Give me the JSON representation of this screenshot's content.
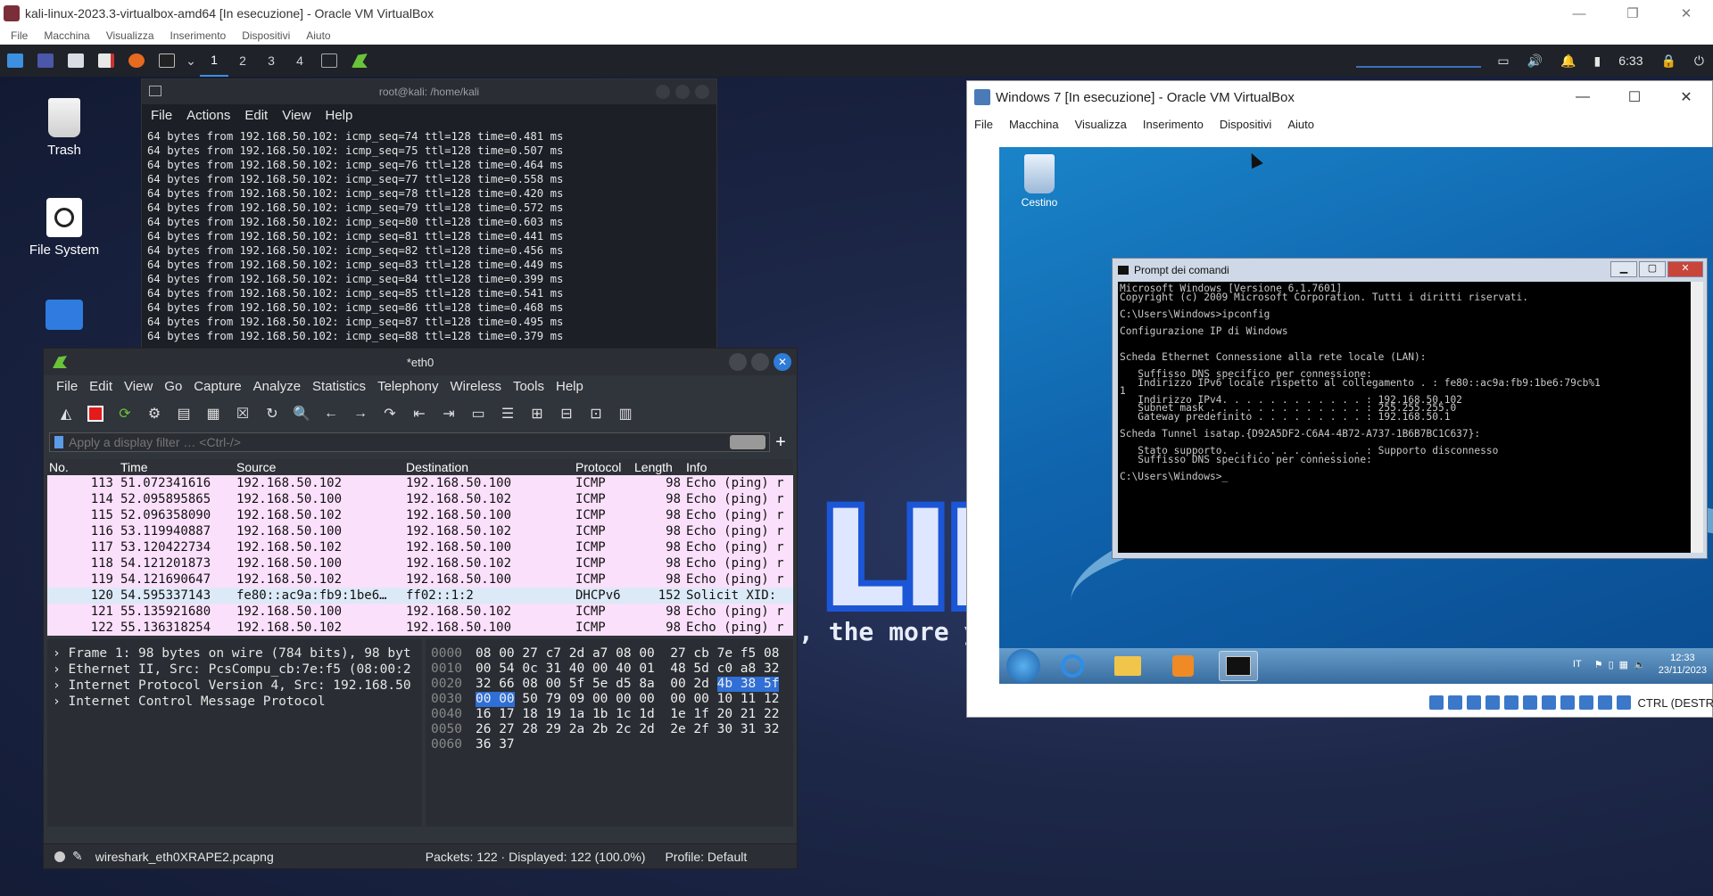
{
  "host": {
    "title": "kali-linux-2023.3-virtualbox-amd64 [In esecuzione] - Oracle VM VirtualBox",
    "menu": [
      "File",
      "Macchina",
      "Visualizza",
      "Inserimento",
      "Dispositivi",
      "Aiuto"
    ]
  },
  "kali_panel": {
    "workspaces": [
      "1",
      "2",
      "3",
      "4"
    ],
    "active_workspace": "1",
    "clock": "6:33"
  },
  "desktop": {
    "icons": [
      "Trash",
      "File System"
    ],
    "slogan": ", the more yo",
    "logo_text": "LII"
  },
  "terminal": {
    "title": "root@kali: /home/kali",
    "menu": [
      "File",
      "Actions",
      "Edit",
      "View",
      "Help"
    ],
    "lines": [
      "64 bytes from 192.168.50.102: icmp_seq=74 ttl=128 time=0.481 ms",
      "64 bytes from 192.168.50.102: icmp_seq=75 ttl=128 time=0.507 ms",
      "64 bytes from 192.168.50.102: icmp_seq=76 ttl=128 time=0.464 ms",
      "64 bytes from 192.168.50.102: icmp_seq=77 ttl=128 time=0.558 ms",
      "64 bytes from 192.168.50.102: icmp_seq=78 ttl=128 time=0.420 ms",
      "64 bytes from 192.168.50.102: icmp_seq=79 ttl=128 time=0.572 ms",
      "64 bytes from 192.168.50.102: icmp_seq=80 ttl=128 time=0.603 ms",
      "64 bytes from 192.168.50.102: icmp_seq=81 ttl=128 time=0.441 ms",
      "64 bytes from 192.168.50.102: icmp_seq=82 ttl=128 time=0.456 ms",
      "64 bytes from 192.168.50.102: icmp_seq=83 ttl=128 time=0.449 ms",
      "64 bytes from 192.168.50.102: icmp_seq=84 ttl=128 time=0.399 ms",
      "64 bytes from 192.168.50.102: icmp_seq=85 ttl=128 time=0.541 ms",
      "64 bytes from 192.168.50.102: icmp_seq=86 ttl=128 time=0.468 ms",
      "64 bytes from 192.168.50.102: icmp_seq=87 ttl=128 time=0.495 ms",
      "64 bytes from 192.168.50.102: icmp_seq=88 ttl=128 time=0.379 ms"
    ]
  },
  "wireshark": {
    "title": "*eth0",
    "menu": [
      "File",
      "Edit",
      "View",
      "Go",
      "Capture",
      "Analyze",
      "Statistics",
      "Telephony",
      "Wireless",
      "Tools",
      "Help"
    ],
    "filter_placeholder": "Apply a display filter … <Ctrl-/>",
    "columns": [
      "No.",
      "Time",
      "Source",
      "Destination",
      "Protocol",
      "Length",
      "Info"
    ],
    "packets": [
      {
        "no": "113",
        "time": "51.072341616",
        "src": "192.168.50.102",
        "dst": "192.168.50.100",
        "proto": "ICMP",
        "len": "98",
        "info": "Echo (ping) r",
        "kind": "icmp"
      },
      {
        "no": "114",
        "time": "52.095895865",
        "src": "192.168.50.100",
        "dst": "192.168.50.102",
        "proto": "ICMP",
        "len": "98",
        "info": "Echo (ping) r",
        "kind": "icmp"
      },
      {
        "no": "115",
        "time": "52.096358090",
        "src": "192.168.50.102",
        "dst": "192.168.50.100",
        "proto": "ICMP",
        "len": "98",
        "info": "Echo (ping) r",
        "kind": "icmp"
      },
      {
        "no": "116",
        "time": "53.119940887",
        "src": "192.168.50.100",
        "dst": "192.168.50.102",
        "proto": "ICMP",
        "len": "98",
        "info": "Echo (ping) r",
        "kind": "icmp"
      },
      {
        "no": "117",
        "time": "53.120422734",
        "src": "192.168.50.102",
        "dst": "192.168.50.100",
        "proto": "ICMP",
        "len": "98",
        "info": "Echo (ping) r",
        "kind": "icmp"
      },
      {
        "no": "118",
        "time": "54.121201873",
        "src": "192.168.50.100",
        "dst": "192.168.50.102",
        "proto": "ICMP",
        "len": "98",
        "info": "Echo (ping) r",
        "kind": "icmp"
      },
      {
        "no": "119",
        "time": "54.121690647",
        "src": "192.168.50.102",
        "dst": "192.168.50.100",
        "proto": "ICMP",
        "len": "98",
        "info": "Echo (ping) r",
        "kind": "icmp"
      },
      {
        "no": "120",
        "time": "54.595337143",
        "src": "fe80::ac9a:fb9:1be6…",
        "dst": "ff02::1:2",
        "proto": "DHCPv6",
        "len": "152",
        "info": "Solicit XID:",
        "kind": "dhcp"
      },
      {
        "no": "121",
        "time": "55.135921680",
        "src": "192.168.50.100",
        "dst": "192.168.50.102",
        "proto": "ICMP",
        "len": "98",
        "info": "Echo (ping) r",
        "kind": "icmp"
      },
      {
        "no": "122",
        "time": "55.136318254",
        "src": "192.168.50.102",
        "dst": "192.168.50.100",
        "proto": "ICMP",
        "len": "98",
        "info": "Echo (ping) r",
        "kind": "icmp"
      }
    ],
    "details": [
      "Frame 1: 98 bytes on wire (784 bits), 98 byt",
      "Ethernet II, Src: PcsCompu_cb:7e:f5 (08:00:2",
      "Internet Protocol Version 4, Src: 192.168.50",
      "Internet Control Message Protocol"
    ],
    "hex": [
      {
        "off": "0000",
        "bytes": "08 00 27 c7 2d a7 08 00  27 cb 7e f5 08"
      },
      {
        "off": "0010",
        "bytes": "00 54 0c 31 40 00 40 01  48 5d c0 a8 32"
      },
      {
        "off": "0020",
        "bytes": "32 66 08 00 5f 5e d5 8a  00 2d ",
        "sel_after": "4b 38 5f"
      },
      {
        "off": "0030",
        "sel_before": "00 00",
        "bytes": " 50 79 09 00 00 00  00 00 10 11 12"
      },
      {
        "off": "0040",
        "bytes": "16 17 18 19 1a 1b 1c 1d  1e 1f 20 21 22"
      },
      {
        "off": "0050",
        "bytes": "26 27 28 29 2a 2b 2c 2d  2e 2f 30 31 32"
      },
      {
        "off": "0060",
        "bytes": "36 37"
      }
    ],
    "status_file": "wireshark_eth0XRAPE2.pcapng",
    "status_packets": "Packets: 122 · Displayed: 122 (100.0%)",
    "status_profile": "Profile: Default"
  },
  "win7_vm": {
    "title": "Windows 7 [In esecuzione] - Oracle VM VirtualBox",
    "menu": [
      "File",
      "Macchina",
      "Visualizza",
      "Inserimento",
      "Dispositivi",
      "Aiuto"
    ],
    "status_right": "CTRL (DESTR",
    "desktop_icon": "Cestino",
    "cmd_title": "Prompt dei comandi",
    "cmd_lines": [
      "Microsoft Windows [Versione 6.1.7601]",
      "Copyright (c) 2009 Microsoft Corporation. Tutti i diritti riservati.",
      "",
      "C:\\Users\\Windows>ipconfig",
      "",
      "Configurazione IP di Windows",
      "",
      "",
      "Scheda Ethernet Connessione alla rete locale (LAN):",
      "",
      "   Suffisso DNS specifico per connessione:",
      "   Indirizzo IPv6 locale rispetto al collegamento . : fe80::ac9a:fb9:1be6:79cb%1",
      "1",
      "   Indirizzo IPv4. . . . . . . . . . . . : 192.168.50.102",
      "   Subnet mask . . . . . . . . . . . . . : 255.255.255.0",
      "   Gateway predefinito . . . . . . . . . : 192.168.50.1",
      "",
      "Scheda Tunnel isatap.{D92A5DF2-C6A4-4B72-A737-1B6B7BC1C637}:",
      "",
      "   Stato supporto. . . . . . . . . . . . : Supporto disconnesso",
      "   Suffisso DNS specifico per connessione:",
      "",
      "C:\\Users\\Windows>_"
    ],
    "tray_lang": "IT",
    "tray_time": "12:33",
    "tray_date": "23/11/2023"
  },
  "colors": {
    "icmp_row": "#fbe0fb",
    "dhcp_row": "#dce9f7",
    "selection": "#2f6fd6",
    "kali_blue": "#1b56d6"
  }
}
